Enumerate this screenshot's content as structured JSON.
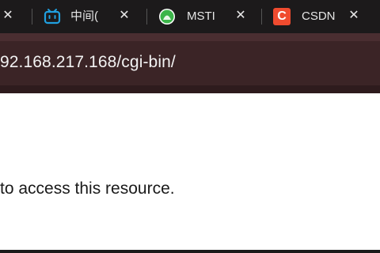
{
  "tabs": [
    {
      "title": "",
      "close_label": "✕",
      "favicon": "none"
    },
    {
      "title": "中间(",
      "close_label": "✕",
      "favicon": "bilibili-icon",
      "favicon_color": "#20a0e0"
    },
    {
      "title": "MSTI",
      "close_label": "✕",
      "favicon": "mst-icon",
      "favicon_color": "#3cb54a"
    },
    {
      "title": "CSDN",
      "close_label": "✕",
      "favicon": "csdn-icon",
      "favicon_color": "#f04b2f",
      "favicon_letter": "C"
    }
  ],
  "address_bar": {
    "url": "92.168.217.168/cgi-bin/"
  },
  "page": {
    "message": "to access this resource."
  },
  "colors": {
    "tabstrip": "#1c1a1b",
    "toolbar": "#3b2426",
    "page": "#ffffff"
  }
}
